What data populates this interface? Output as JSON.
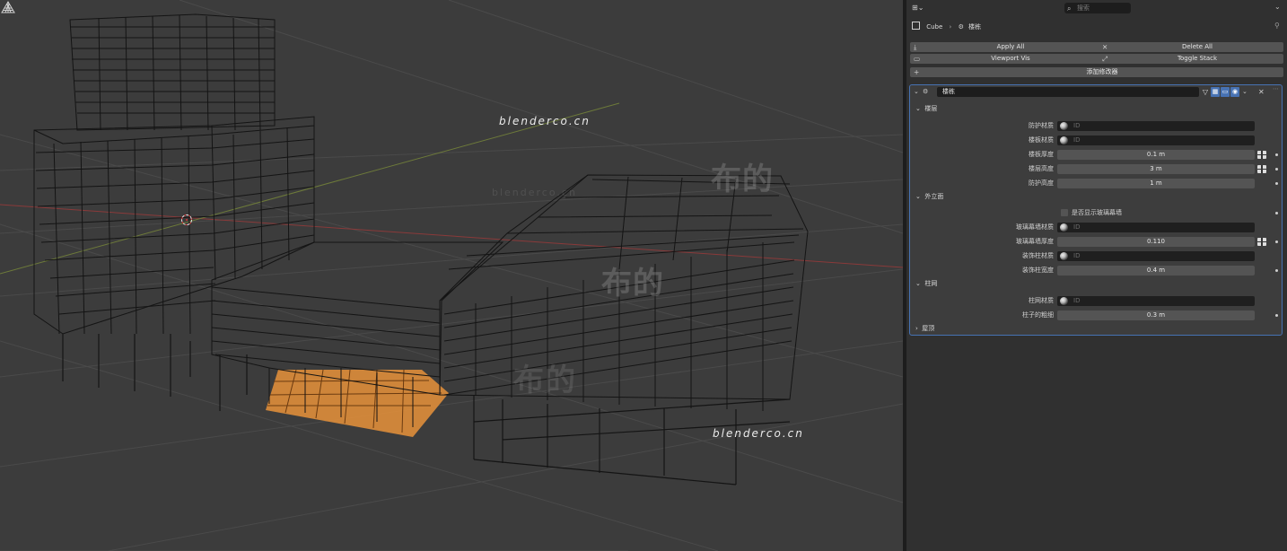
{
  "watermarks": {
    "url_top": "blenderco.cn",
    "url_bottom": "blenderco.cn",
    "brand_1": "布的",
    "brand_2": "布的",
    "brand_3": "布的",
    "faint_url": "blenderco.cn"
  },
  "properties": {
    "search_placeholder": "搜索",
    "breadcrumb": {
      "object": "Cube",
      "modifier": "楼栋"
    },
    "buttons": {
      "apply_all": "Apply All",
      "delete_all": "Delete All",
      "viewport_vis": "Viewport Vis",
      "toggle_stack": "Toggle Stack",
      "add_modifier": "添加修改器"
    },
    "modifier": {
      "name": "楼栋",
      "sections": {
        "floors": {
          "title": "楼层",
          "rows": [
            {
              "label": "防护材质",
              "value": "ID"
            },
            {
              "label": "楼板材质",
              "value": "ID"
            },
            {
              "label": "楼板厚度",
              "value": "0.1 m"
            },
            {
              "label": "楼层高度",
              "value": "3 m"
            },
            {
              "label": "防护高度",
              "value": "1 m"
            }
          ]
        },
        "facade": {
          "title": "外立面",
          "checkbox_label": "是否显示玻璃幕墙",
          "rows": [
            {
              "label": "玻璃幕墙材质",
              "value": "ID"
            },
            {
              "label": "玻璃幕墙厚度",
              "value": "0.110"
            },
            {
              "label": "装饰柱材质",
              "value": "ID"
            },
            {
              "label": "装饰柱宽度",
              "value": "0.4 m"
            }
          ]
        },
        "columns": {
          "title": "柱网",
          "rows": [
            {
              "label": "柱网材质",
              "value": "ID"
            },
            {
              "label": "柱子的粗细",
              "value": "0.3 m"
            }
          ]
        },
        "roof": {
          "title": "屋顶"
        }
      }
    }
  },
  "colors": {
    "viewport_bg": "#3c3c3c",
    "panel_bg": "#303030",
    "accent": "#4772b3",
    "selection": "#e8923a",
    "wire": "#141414"
  }
}
